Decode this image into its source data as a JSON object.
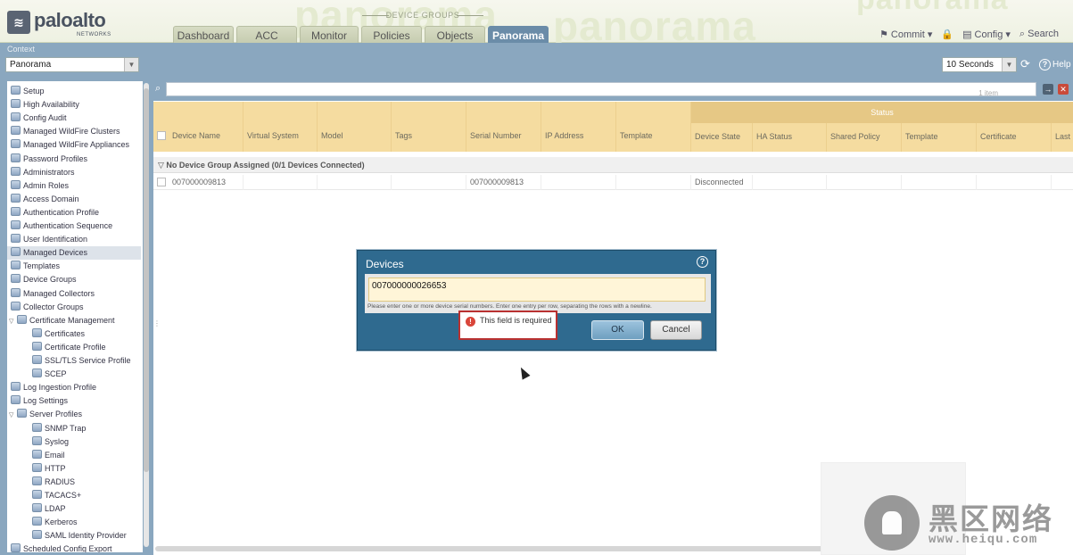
{
  "app": {
    "brand": "paloalto",
    "brand_sub": "NETWORKS",
    "bg_words": [
      "panorama",
      "panorama",
      "panorama"
    ],
    "device_groups_label": "DEVICE GROUPS"
  },
  "tabs": [
    {
      "label": "Dashboard"
    },
    {
      "label": "ACC"
    },
    {
      "label": "Monitor"
    },
    {
      "label": "Policies"
    },
    {
      "label": "Objects"
    },
    {
      "label": "Panorama"
    }
  ],
  "topright": {
    "commit": "Commit",
    "config": "Config",
    "search": "Search"
  },
  "context": {
    "title": "Context",
    "value": "Panorama"
  },
  "refresh": {
    "value": "10 Seconds",
    "help": "Help"
  },
  "sidebar": {
    "items": [
      {
        "label": "Setup",
        "indent": 0
      },
      {
        "label": "High Availability",
        "indent": 0
      },
      {
        "label": "Config Audit",
        "indent": 0
      },
      {
        "label": "Managed WildFire Clusters",
        "indent": 0
      },
      {
        "label": "Managed WildFire Appliances",
        "indent": 0
      },
      {
        "label": "Password Profiles",
        "indent": 0
      },
      {
        "label": "Administrators",
        "indent": 0
      },
      {
        "label": "Admin Roles",
        "indent": 0
      },
      {
        "label": "Access Domain",
        "indent": 0
      },
      {
        "label": "Authentication Profile",
        "indent": 0
      },
      {
        "label": "Authentication Sequence",
        "indent": 0
      },
      {
        "label": "User Identification",
        "indent": 0
      },
      {
        "label": "Managed Devices",
        "indent": 0,
        "selected": true
      },
      {
        "label": "Templates",
        "indent": 0
      },
      {
        "label": "Device Groups",
        "indent": 0
      },
      {
        "label": "Managed Collectors",
        "indent": 0
      },
      {
        "label": "Collector Groups",
        "indent": 0
      },
      {
        "label": "Certificate Management",
        "indent": 0,
        "expanded": true
      },
      {
        "label": "Certificates",
        "indent": 1
      },
      {
        "label": "Certificate Profile",
        "indent": 1
      },
      {
        "label": "SSL/TLS Service Profile",
        "indent": 1
      },
      {
        "label": "SCEP",
        "indent": 1
      },
      {
        "label": "Log Ingestion Profile",
        "indent": 0
      },
      {
        "label": "Log Settings",
        "indent": 0
      },
      {
        "label": "Server Profiles",
        "indent": 0,
        "expanded": true
      },
      {
        "label": "SNMP Trap",
        "indent": 1
      },
      {
        "label": "Syslog",
        "indent": 1
      },
      {
        "label": "Email",
        "indent": 1
      },
      {
        "label": "HTTP",
        "indent": 1
      },
      {
        "label": "RADIUS",
        "indent": 1
      },
      {
        "label": "TACACS+",
        "indent": 1
      },
      {
        "label": "LDAP",
        "indent": 1
      },
      {
        "label": "Kerberos",
        "indent": 1
      },
      {
        "label": "SAML Identity Provider",
        "indent": 1
      },
      {
        "label": "Scheduled Config Export",
        "indent": 0
      }
    ]
  },
  "filter": {
    "count": "1 item"
  },
  "grid": {
    "status_group": "Status",
    "columns": [
      "Device Name",
      "Virtual System",
      "Model",
      "Tags",
      "Serial Number",
      "IP Address",
      "Template"
    ],
    "status_columns": [
      "Device State",
      "HA Status",
      "Shared Policy",
      "Template",
      "Certificate",
      "Last"
    ],
    "group_row": "No Device Group Assigned (0/1 Devices Connected)",
    "row": {
      "device_name": "007000009813",
      "serial_number": "007000009813",
      "device_state": "Disconnected"
    }
  },
  "modal": {
    "title": "Devices",
    "input_value": "007000000026653",
    "hint": "Please enter one or more device serial numbers. Enter one entry per row, separating the rows with a newline.",
    "error": "This field is required",
    "ok": "OK",
    "cancel": "Cancel"
  },
  "watermark": {
    "cn": "黑区网络",
    "url": "www.heiqu.com"
  }
}
